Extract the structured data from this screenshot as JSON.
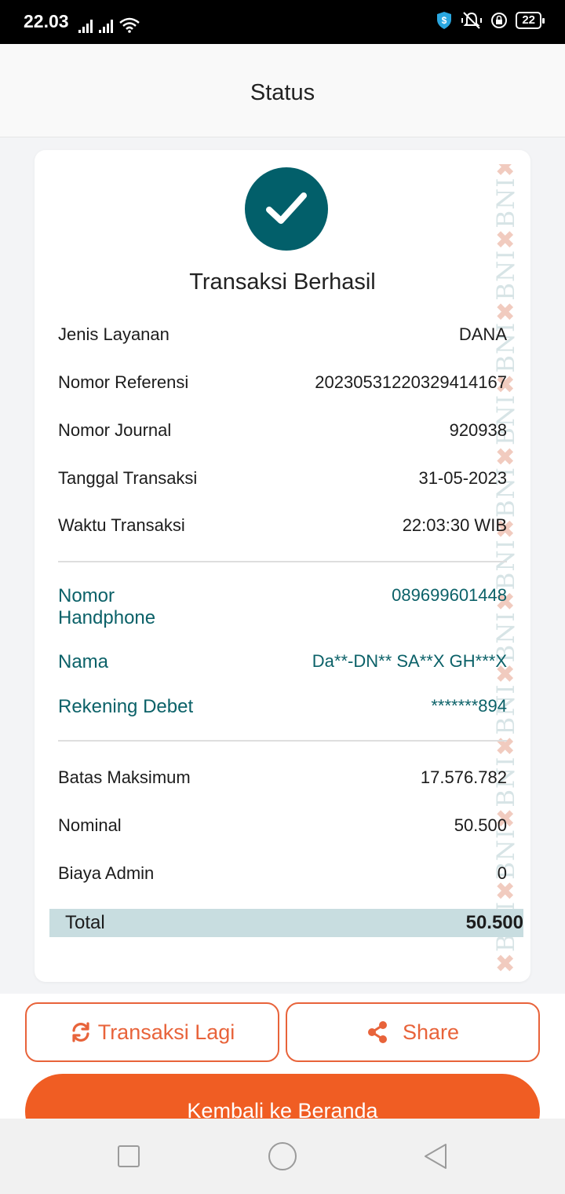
{
  "status_bar": {
    "time": "22.03",
    "battery": "22"
  },
  "header": {
    "title": "Status"
  },
  "receipt": {
    "title": "Transaksi Berhasil",
    "watermark": "BNI",
    "details": [
      {
        "label": "Jenis Layanan",
        "value": "DANA"
      },
      {
        "label": "Nomor Referensi",
        "value": "20230531220329414167"
      },
      {
        "label": "Nomor Journal",
        "value": "920938"
      },
      {
        "label": "Tanggal Transaksi",
        "value": "31-05-2023"
      },
      {
        "label": "Waktu Transaksi",
        "value": "22:03:30 WIB"
      }
    ],
    "customer": [
      {
        "label": "Nomor Handphone",
        "value": "089699601448"
      },
      {
        "label": "Nama",
        "value": "Da**-DN** SA**X GH***X"
      },
      {
        "label": "Rekening Debet",
        "value": "*******894"
      }
    ],
    "amounts": [
      {
        "label": "Batas Maksimum",
        "value": "17.576.782"
      },
      {
        "label": "Nominal",
        "value": "50.500"
      },
      {
        "label": "Biaya Admin",
        "value": "0"
      }
    ],
    "total": {
      "label": "Total",
      "value": "50.500"
    }
  },
  "actions": {
    "again_label": "Transaksi Lagi",
    "share_label": "Share",
    "home_label": "Kembali ke Beranda"
  },
  "colors": {
    "brand_teal": "#025f6a",
    "accent_orange": "#f05d23"
  }
}
